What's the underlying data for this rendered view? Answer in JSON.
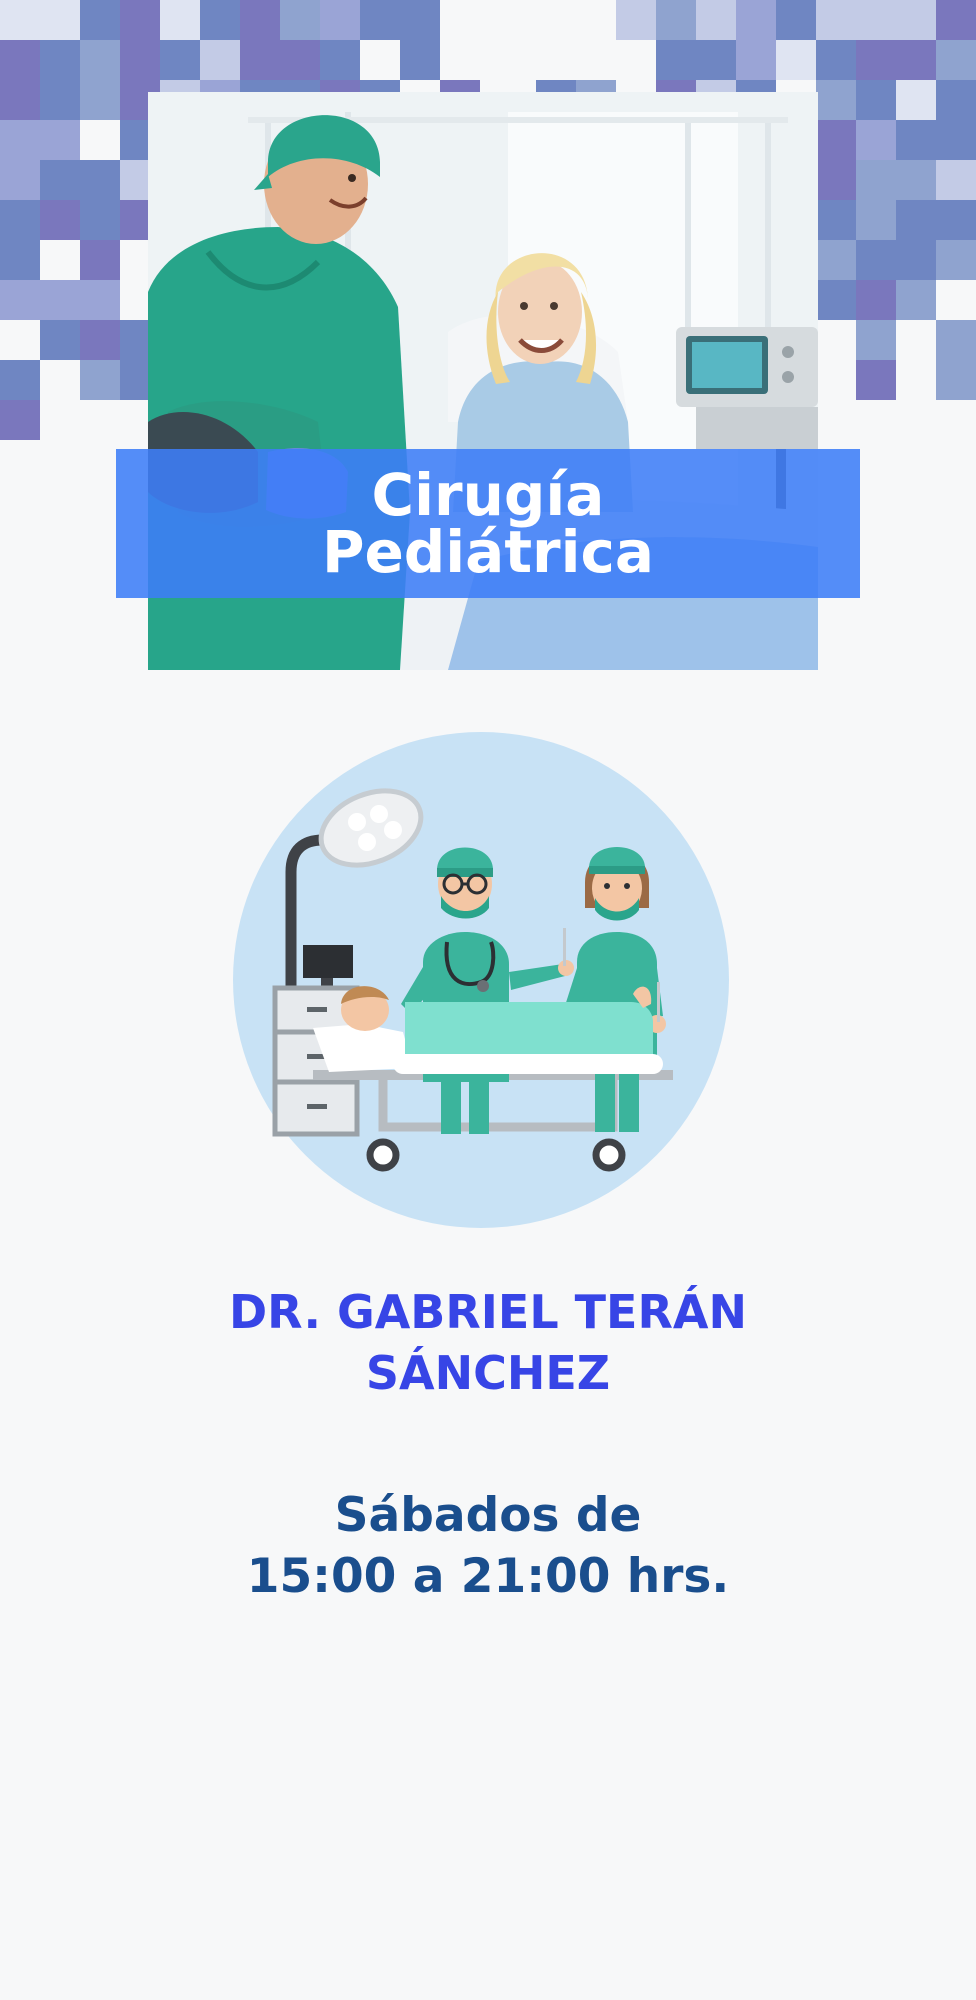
{
  "banner": {
    "title_line1": "Cirugía",
    "title_line2": "Pediátrica"
  },
  "doctor": {
    "name_line1": "DR. GABRIEL TERÁN",
    "name_line2": "SÁNCHEZ"
  },
  "schedule": {
    "line1": "Sábados de",
    "line2": "15:00 a 21:00 hrs."
  },
  "colors": {
    "band_blue": "#3d7df7",
    "name_blue": "#3745e6",
    "schedule_blue": "#1a4e8d",
    "illustration_circle": "#c8e2f5",
    "scrubs_teal": "#3bb49c"
  },
  "icons": {
    "illustration": "surgery-team-icon"
  }
}
